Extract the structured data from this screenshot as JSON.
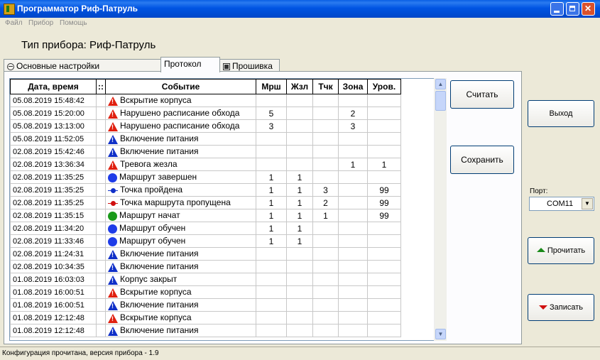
{
  "window": {
    "title": "Программатор Риф-Патруль"
  },
  "menu": [
    "Файл",
    "Прибор",
    "Помощь"
  ],
  "device_title": "Тип прибора: Риф-Патруль",
  "tabs": [
    {
      "label": "Основные настройки",
      "icon": "circle-minus-icon",
      "active": false
    },
    {
      "label": "Протокол",
      "icon": "",
      "active": true
    },
    {
      "label": "Прошивка",
      "icon": "square-icon",
      "active": false
    }
  ],
  "table": {
    "headers": [
      "Дата, время",
      "::",
      "Событие",
      "Мрш",
      "Жзл",
      "Тчк",
      "Зона",
      "Уров."
    ],
    "rows": [
      {
        "dt": "05.08.2019 15:48:42",
        "icon": "warning-red-icon",
        "event": "Вскрытие корпуса",
        "mrsh": "",
        "zhzl": "",
        "tchk": "",
        "zona": "",
        "urov": ""
      },
      {
        "dt": "05.08.2019 15:20:00",
        "icon": "warning-red-icon",
        "event": "Нарушено расписание обхода",
        "mrsh": "5",
        "zhzl": "",
        "tchk": "",
        "zona": "2",
        "urov": ""
      },
      {
        "dt": "05.08.2019 13:13:00",
        "icon": "warning-red-icon",
        "event": "Нарушено расписание обхода",
        "mrsh": "3",
        "zhzl": "",
        "tchk": "",
        "zona": "3",
        "urov": ""
      },
      {
        "dt": "05.08.2019 11:52:05",
        "icon": "warning-blue-icon",
        "event": "Включение питания",
        "mrsh": "",
        "zhzl": "",
        "tchk": "",
        "zona": "",
        "urov": ""
      },
      {
        "dt": "02.08.2019 15:42:46",
        "icon": "warning-blue-icon",
        "event": "Включение питания",
        "mrsh": "",
        "zhzl": "",
        "tchk": "",
        "zona": "",
        "urov": ""
      },
      {
        "dt": "02.08.2019 13:36:34",
        "icon": "warning-red-icon",
        "event": "Тревога жезла",
        "mrsh": "",
        "zhzl": "",
        "tchk": "",
        "zona": "1",
        "urov": "1"
      },
      {
        "dt": "02.08.2019 11:35:25",
        "icon": "circle-blue-icon",
        "event": "Маршрут завершен",
        "mrsh": "1",
        "zhzl": "1",
        "tchk": "",
        "zona": "",
        "urov": ""
      },
      {
        "dt": "02.08.2019 11:35:25",
        "icon": "point-blue-icon",
        "event": "Точка пройдена",
        "mrsh": "1",
        "zhzl": "1",
        "tchk": "3",
        "zona": "",
        "urov": "99"
      },
      {
        "dt": "02.08.2019 11:35:25",
        "icon": "point-red-icon",
        "event": "Точка маршрута пропущена",
        "mrsh": "1",
        "zhzl": "1",
        "tchk": "2",
        "zona": "",
        "urov": "99"
      },
      {
        "dt": "02.08.2019 11:35:15",
        "icon": "circle-green-icon",
        "event": "Маршрут начат",
        "mrsh": "1",
        "zhzl": "1",
        "tchk": "1",
        "zona": "",
        "urov": "99"
      },
      {
        "dt": "02.08.2019 11:34:20",
        "icon": "circle-blue-icon",
        "event": "Маршрут обучен",
        "mrsh": "1",
        "zhzl": "1",
        "tchk": "",
        "zona": "",
        "urov": ""
      },
      {
        "dt": "02.08.2019 11:33:46",
        "icon": "circle-blue-icon",
        "event": "Маршрут обучен",
        "mrsh": "1",
        "zhzl": "1",
        "tchk": "",
        "zona": "",
        "urov": ""
      },
      {
        "dt": "02.08.2019 11:24:31",
        "icon": "warning-blue-icon",
        "event": "Включение питания",
        "mrsh": "",
        "zhzl": "",
        "tchk": "",
        "zona": "",
        "urov": ""
      },
      {
        "dt": "02.08.2019 10:34:35",
        "icon": "warning-blue-icon",
        "event": "Включение питания",
        "mrsh": "",
        "zhzl": "",
        "tchk": "",
        "zona": "",
        "urov": ""
      },
      {
        "dt": "01.08.2019 16:03:03",
        "icon": "warning-blue-icon",
        "event": "Корпус закрыт",
        "mrsh": "",
        "zhzl": "",
        "tchk": "",
        "zona": "",
        "urov": ""
      },
      {
        "dt": "01.08.2019 16:00:51",
        "icon": "warning-red-icon",
        "event": "Вскрытие корпуса",
        "mrsh": "",
        "zhzl": "",
        "tchk": "",
        "zona": "",
        "urov": ""
      },
      {
        "dt": "01.08.2019 16:00:51",
        "icon": "warning-blue-icon",
        "event": "Включение питания",
        "mrsh": "",
        "zhzl": "",
        "tchk": "",
        "zona": "",
        "urov": ""
      },
      {
        "dt": "01.08.2019 12:12:48",
        "icon": "warning-red-icon",
        "event": "Вскрытие корпуса",
        "mrsh": "",
        "zhzl": "",
        "tchk": "",
        "zona": "",
        "urov": ""
      },
      {
        "dt": "01.08.2019 12:12:48",
        "icon": "warning-blue-icon",
        "event": "Включение питания",
        "mrsh": "",
        "zhzl": "",
        "tchk": "",
        "zona": "",
        "urov": ""
      }
    ]
  },
  "buttons": {
    "read": "Считать",
    "save": "Сохранить",
    "exit": "Выход",
    "read_port": "Прочитать",
    "write_port": "Записать"
  },
  "port": {
    "label": "Порт:",
    "value": "COM11"
  },
  "status": "Конфигурация прочитана, версия прибора - 1.9",
  "colors": {
    "title_bar": "#0054E3",
    "warning_red": "#E02010",
    "warning_blue": "#1030C8",
    "marker_green": "#1A9A1A"
  }
}
